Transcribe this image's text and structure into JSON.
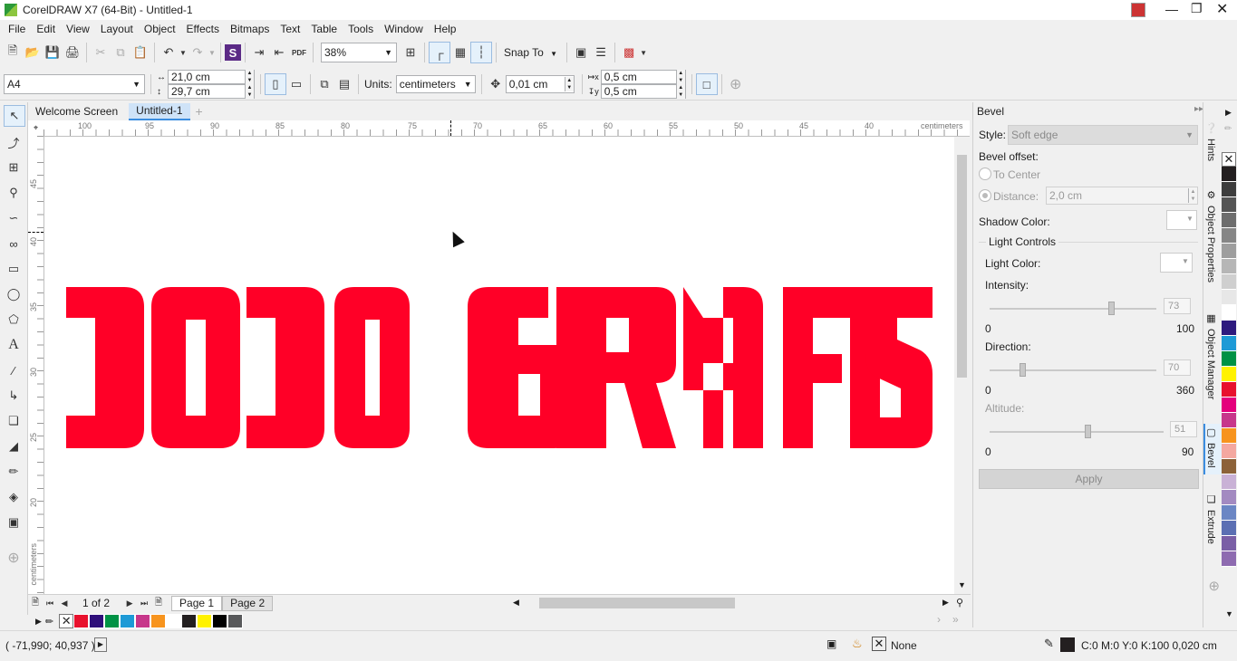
{
  "window": {
    "title": "CorelDRAW X7 (64-Bit) - Untitled-1"
  },
  "menu": [
    "File",
    "Edit",
    "View",
    "Layout",
    "Object",
    "Effects",
    "Bitmaps",
    "Text",
    "Table",
    "Tools",
    "Window",
    "Help"
  ],
  "toolbar": {
    "zoom": "38%",
    "snap_to": "Snap To"
  },
  "propertybar": {
    "page_size": "A4",
    "width": "21,0 cm",
    "height": "29,7 cm",
    "units_label": "Units:",
    "units": "centimeters",
    "nudge": "0,01 cm",
    "dup_x": "0,5 cm",
    "dup_y": "0,5 cm"
  },
  "doc_tabs": [
    "Welcome Screen",
    "Untitled-1"
  ],
  "ruler": {
    "h_ticks": [
      "100",
      "95",
      "90",
      "85",
      "80",
      "75",
      "70",
      "65",
      "60",
      "55",
      "50",
      "45",
      "40"
    ],
    "h_unit": "centimeters",
    "v_ticks": [
      "45",
      "40",
      "35",
      "30",
      "25",
      "20"
    ],
    "v_unit": "centimeters"
  },
  "canvas": {
    "text": "DODO GRAFIS",
    "text_color": "#ff0027"
  },
  "pages": {
    "counter": "1 of 2",
    "tabs": [
      "Page 1",
      "Page 2"
    ]
  },
  "docker": {
    "title": "Bevel",
    "style_label": "Style:",
    "style_value": "Soft edge",
    "offset_label": "Bevel offset:",
    "to_center": "To Center",
    "distance_label": "Distance:",
    "distance_value": "2,0 cm",
    "shadow_color_label": "Shadow Color:",
    "light_controls": "Light Controls",
    "light_color_label": "Light Color:",
    "intensity_label": "Intensity:",
    "intensity_value": "73",
    "intensity_min": "0",
    "intensity_max": "100",
    "direction_label": "Direction:",
    "direction_value": "70",
    "direction_min": "0",
    "direction_max": "360",
    "altitude_label": "Altitude:",
    "altitude_value": "51",
    "altitude_min": "0",
    "altitude_max": "90",
    "apply": "Apply"
  },
  "side_tabs": [
    "Hints",
    "Object Properties",
    "Object Manager",
    "Bevel",
    "Extrude"
  ],
  "status": {
    "coords": "( -71,990; 40,937 )",
    "fill": "None",
    "outline": "C:0 M:0 Y:0 K:100  0,020 cm"
  },
  "palette_colors": [
    "#e8112d",
    "#2f0f7a",
    "#009245",
    "#1e9ad6",
    "#c7378b",
    "#f7941e",
    "#ffffff",
    "#231f20",
    "#fff200",
    "#000000",
    "#58595b"
  ],
  "vpalette_colors": [
    "#231f20",
    "#3d3d3d",
    "#555555",
    "#6d6d6d",
    "#868686",
    "#9e9e9e",
    "#b6b6b6",
    "#cfcfcf",
    "#e7e7e7",
    "#ffffff",
    "#2e1a7e",
    "#1e9ad6",
    "#009245",
    "#fff200",
    "#e8112d",
    "#e4007c",
    "#c7378b",
    "#f7941e",
    "#f4a8a0",
    "#8c6239",
    "#c9b1d6",
    "#a38ac1",
    "#6b86c4",
    "#5b6fb3",
    "#7a5fa6",
    "#8e6bb0"
  ]
}
